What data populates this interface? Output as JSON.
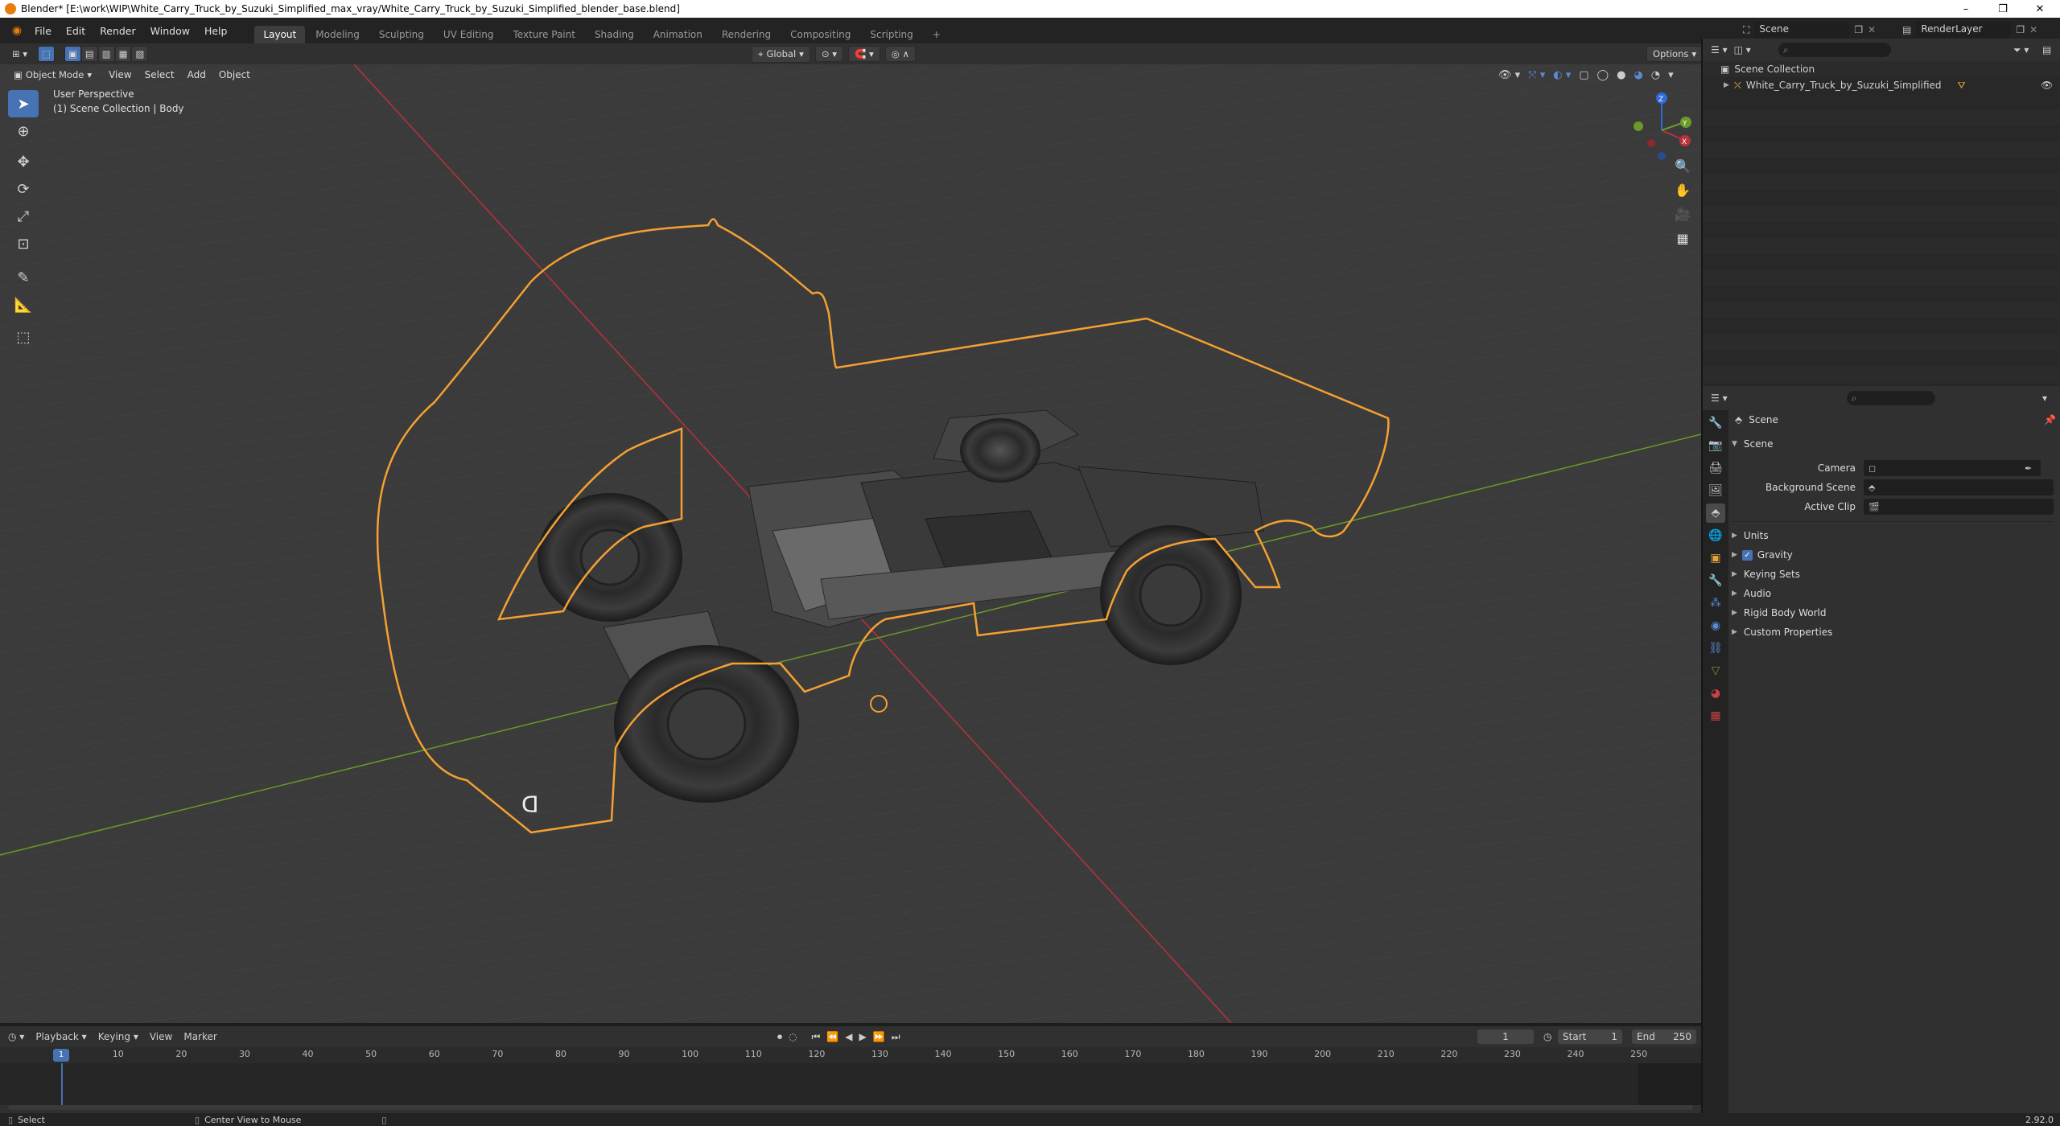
{
  "window": {
    "title": "Blender* [E:\\work\\WIP\\White_Carry_Truck_by_Suzuki_Simplified_max_vray/White_Carry_Truck_by_Suzuki_Simplified_blender_base.blend]",
    "minimize": "–",
    "maximize": "❐",
    "close": "✕"
  },
  "menu": {
    "items": [
      "File",
      "Edit",
      "Render",
      "Window",
      "Help"
    ]
  },
  "workspaces": [
    "Layout",
    "Modeling",
    "Sculpting",
    "UV Editing",
    "Texture Paint",
    "Shading",
    "Animation",
    "Rendering",
    "Compositing",
    "Scripting"
  ],
  "add_workspace": "+",
  "scene_selector": {
    "label": "Scene"
  },
  "view_layer_selector": {
    "label": "RenderLayer"
  },
  "viewport_header": {
    "mode": "Object Mode",
    "menus": [
      "View",
      "Select",
      "Add",
      "Object"
    ],
    "orientation": "Global",
    "options": "Options"
  },
  "viewport": {
    "perspective_label": "User Perspective",
    "collection_label": "(1) Scene Collection | Body",
    "gizmo": {
      "x": "X",
      "y": "Y",
      "z": "Z"
    }
  },
  "outliner": {
    "root": "Scene Collection",
    "items": [
      {
        "label": "White_Carry_Truck_by_Suzuki_Simplified"
      }
    ]
  },
  "properties": {
    "scene_name": "Scene",
    "section_title": "Scene",
    "fields": [
      {
        "label": "Camera",
        "value": ""
      },
      {
        "label": "Background Scene",
        "value": ""
      },
      {
        "label": "Active Clip",
        "value": ""
      }
    ],
    "panels": [
      "Units",
      "Gravity",
      "Keying Sets",
      "Audio",
      "Rigid Body World",
      "Custom Properties"
    ],
    "gravity_checked": true
  },
  "timeline": {
    "menus": [
      "Playback",
      "Keying",
      "View",
      "Marker"
    ],
    "current_frame": "1",
    "start_label": "Start",
    "start": "1",
    "end_label": "End",
    "end": "250",
    "ruler": [
      "1",
      "10",
      "20",
      "30",
      "40",
      "50",
      "60",
      "70",
      "80",
      "90",
      "100",
      "110",
      "120",
      "130",
      "140",
      "150",
      "160",
      "170",
      "180",
      "190",
      "200",
      "210",
      "220",
      "230",
      "240",
      "250"
    ]
  },
  "statusbar": {
    "select": "Select",
    "center_view": "Center View to Mouse",
    "version": "2.92.0"
  },
  "colors": {
    "accent": "#4772b3",
    "selection_outline": "#f5a032",
    "x_axis": "#b8323c",
    "y_axis": "#6a9a28",
    "z_axis": "#2f6ad8"
  }
}
